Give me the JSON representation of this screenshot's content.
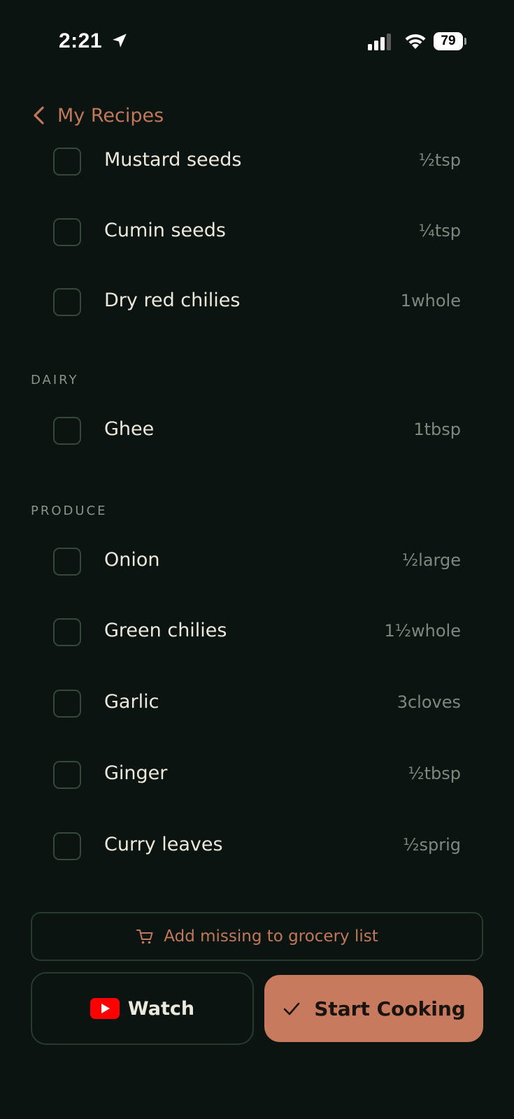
{
  "status_bar": {
    "time": "2:21",
    "battery": "79",
    "location_icon": "location-arrow-icon",
    "signal_icon": "cellular-signal-icon",
    "wifi_icon": "wifi-icon"
  },
  "nav": {
    "back_label": "My Recipes",
    "back_icon": "chevron-left-icon"
  },
  "sections": {
    "spices_items": [
      {
        "name": "Mustard seeds",
        "qty": "½tsp"
      },
      {
        "name": "Cumin seeds",
        "qty": "¼tsp"
      },
      {
        "name": "Dry red chilies",
        "qty": "1whole"
      }
    ],
    "dairy_title": "DAIRY",
    "dairy_items": [
      {
        "name": "Ghee",
        "qty": "1tbsp"
      }
    ],
    "produce_title": "PRODUCE",
    "produce_items": [
      {
        "name": "Onion",
        "qty": "½large"
      },
      {
        "name": "Green chilies",
        "qty": "1½whole"
      },
      {
        "name": "Garlic",
        "qty": "3cloves"
      },
      {
        "name": "Ginger",
        "qty": "½tbsp"
      },
      {
        "name": "Curry leaves",
        "qty": "½sprig"
      }
    ]
  },
  "actions": {
    "grocery_label": "Add missing to grocery list",
    "grocery_icon": "shopping-cart-icon",
    "watch_label": "Watch",
    "watch_icon": "youtube-icon",
    "start_label": "Start Cooking",
    "start_icon": "checkmark-icon"
  },
  "colors": {
    "background": "#0b1411",
    "accent": "#c87a5e",
    "checkbox_border": "#34483b"
  }
}
